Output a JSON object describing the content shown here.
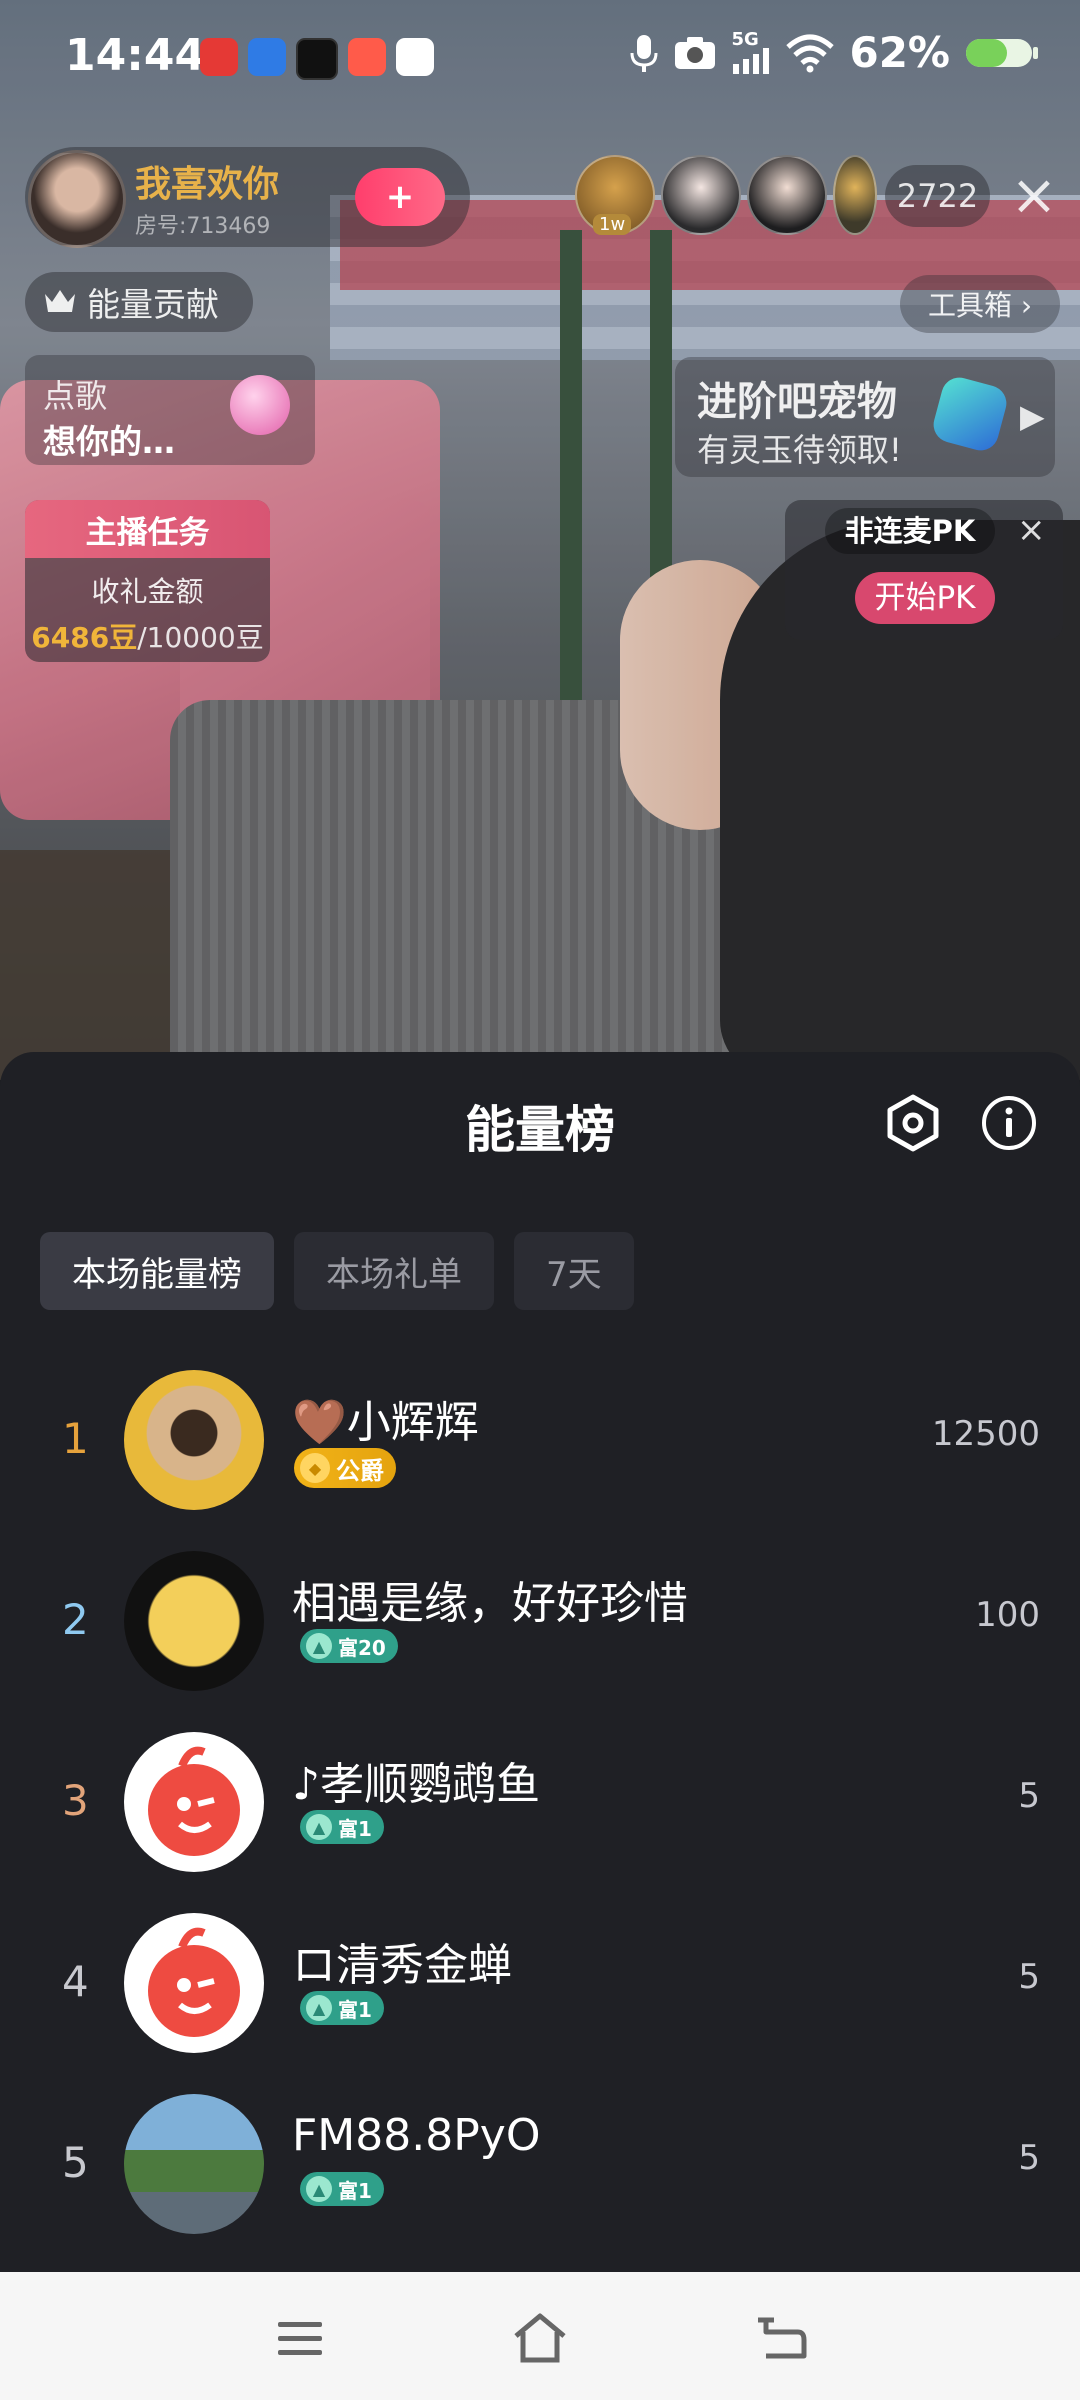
{
  "status_bar": {
    "time": "14:44",
    "network": "5G",
    "battery": "62%"
  },
  "live": {
    "anchor": {
      "name": "我喜欢你",
      "room": "房号:713469",
      "follow": "+"
    },
    "viewers": {
      "first_badge": "1w",
      "count": "2722"
    },
    "energy_contribution": "能量贡献",
    "toolbox": "工具箱 ›",
    "song": {
      "label": "点歌",
      "title": "想你的…"
    },
    "task": {
      "title": "主播任务",
      "subtitle": "收礼金额",
      "current": "6486豆",
      "target": "/10000豆"
    },
    "pet_banner": {
      "title": "进阶吧宠物",
      "subtitle": "有灵玉待领取!"
    },
    "pk": {
      "label": "非连麦PK",
      "start": "开始PK"
    }
  },
  "sheet": {
    "title": "能量榜",
    "tabs": [
      {
        "label": "本场能量榜",
        "active": true
      },
      {
        "label": "本场礼单",
        "active": false
      },
      {
        "label": "7天",
        "active": false
      }
    ],
    "rows": [
      {
        "rank": "1",
        "name": "🤎小辉辉",
        "badge": "公爵",
        "badge_type": "gold",
        "score": "12500",
        "rank_color": "#e6a23c"
      },
      {
        "rank": "2",
        "name": "相遇是缘，好好珍惜",
        "badge": "富20",
        "badge_type": "green",
        "score": "100",
        "rank_color": "#8fc9f0"
      },
      {
        "rank": "3",
        "name": "♪孝顺鹦鹉鱼",
        "badge": "富1",
        "badge_type": "green",
        "score": "5",
        "rank_color": "#e2a47a"
      },
      {
        "rank": "4",
        "name": "ロ清秀金蝉",
        "badge": "富1",
        "badge_type": "green",
        "score": "5",
        "rank_color": "#c8c9cf"
      },
      {
        "rank": "5",
        "name": "FM88.8PyO",
        "badge": "富1",
        "badge_type": "green",
        "score": "5",
        "rank_color": "#c8c9cf"
      }
    ]
  },
  "colors": {
    "sheet_bg": "#1f2025",
    "tab_active": "#3a3b44",
    "accent_gold": "#e8b24a",
    "badge_green": "#2fa08a"
  }
}
